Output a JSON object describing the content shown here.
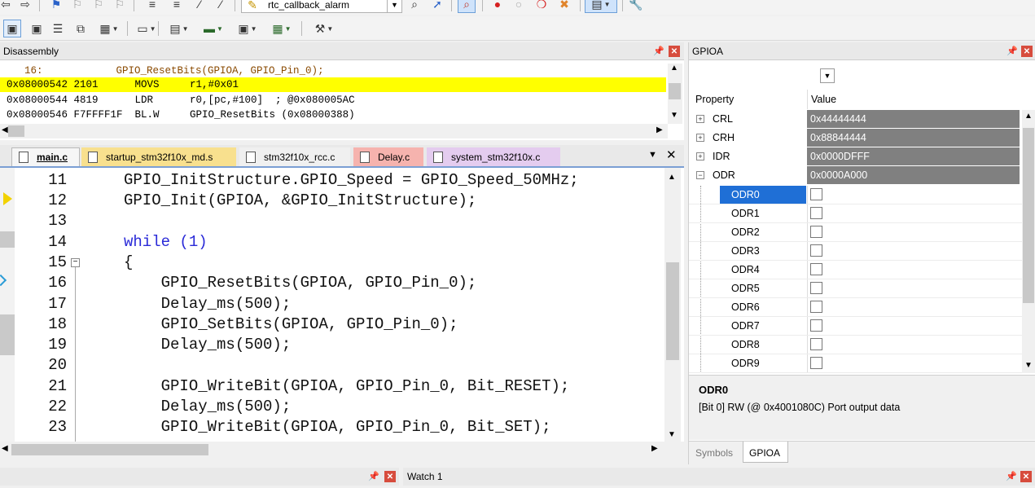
{
  "toolbar": {
    "target_combo": "rtc_callback_alarm"
  },
  "disassembly": {
    "title": "Disassembly",
    "lines": [
      {
        "addr": "",
        "text": "    16:            GPIO_ResetBits(GPIOA, GPIO_Pin_0);",
        "highlight": false
      },
      {
        "addr": "0x08000542 2101",
        "text": "0x08000542 2101      MOVS     r1,#0x01",
        "highlight": true
      },
      {
        "addr": "0x08000544 4819",
        "text": "0x08000544 4819      LDR      r0,[pc,#100]  ; @0x080005AC",
        "highlight": false
      },
      {
        "addr": "0x08000546 F7FFFF1F",
        "text": "0x08000546 F7FFFF1F  BL.W     GPIO_ResetBits (0x08000388)",
        "highlight": false
      }
    ]
  },
  "tabs": [
    {
      "label": "main.c",
      "active": true,
      "color": "#f3f3f3"
    },
    {
      "label": "startup_stm32f10x_md.s",
      "active": false,
      "color": "#f8e08e"
    },
    {
      "label": "stm32f10x_rcc.c",
      "active": false,
      "color": "#f0f0f0"
    },
    {
      "label": "Delay.c",
      "active": false,
      "color": "#f6b3ae"
    },
    {
      "label": "system_stm32f10x.c",
      "active": false,
      "color": "#e4ccef"
    }
  ],
  "editor": {
    "lines": [
      {
        "num": "11",
        "code": "GPIO_InitStructure.GPIO_Speed = GPIO_Speed_50MHz;"
      },
      {
        "num": "12",
        "code": "GPIO_Init(GPIOA, &GPIO_InitStructure);"
      },
      {
        "num": "13",
        "code": ""
      },
      {
        "num": "14",
        "code": "while (1)"
      },
      {
        "num": "15",
        "code": "{"
      },
      {
        "num": "16",
        "code": "    GPIO_ResetBits(GPIOA, GPIO_Pin_0);"
      },
      {
        "num": "17",
        "code": "    Delay_ms(500);"
      },
      {
        "num": "18",
        "code": "    GPIO_SetBits(GPIOA, GPIO_Pin_0);"
      },
      {
        "num": "19",
        "code": "    Delay_ms(500);"
      },
      {
        "num": "20",
        "code": ""
      },
      {
        "num": "21",
        "code": "    GPIO_WriteBit(GPIOA, GPIO_Pin_0, Bit_RESET);"
      },
      {
        "num": "22",
        "code": "    Delay_ms(500);"
      },
      {
        "num": "23",
        "code": "    GPIO_WriteBit(GPIOA, GPIO_Pin_0, Bit_SET);"
      }
    ]
  },
  "gpio": {
    "title": "GPIOA",
    "col_property": "Property",
    "col_value": "Value",
    "registers": [
      {
        "name": "CRL",
        "value": "0x44444444",
        "expander": "+"
      },
      {
        "name": "CRH",
        "value": "0x88844444",
        "expander": "+"
      },
      {
        "name": "IDR",
        "value": "0x0000DFFF",
        "expander": "+"
      },
      {
        "name": "ODR",
        "value": "0x0000A000",
        "expander": "−"
      }
    ],
    "bits": [
      "ODR0",
      "ODR1",
      "ODR2",
      "ODR3",
      "ODR4",
      "ODR5",
      "ODR6",
      "ODR7",
      "ODR8",
      "ODR9"
    ],
    "selected_bit": "ODR0",
    "desc_title": "ODR0",
    "desc_text": "[Bit 0] RW (@ 0x4001080C) Port output data",
    "bottom_tabs": [
      "Symbols",
      "GPIOA"
    ]
  },
  "watch": {
    "title": "Watch 1"
  }
}
